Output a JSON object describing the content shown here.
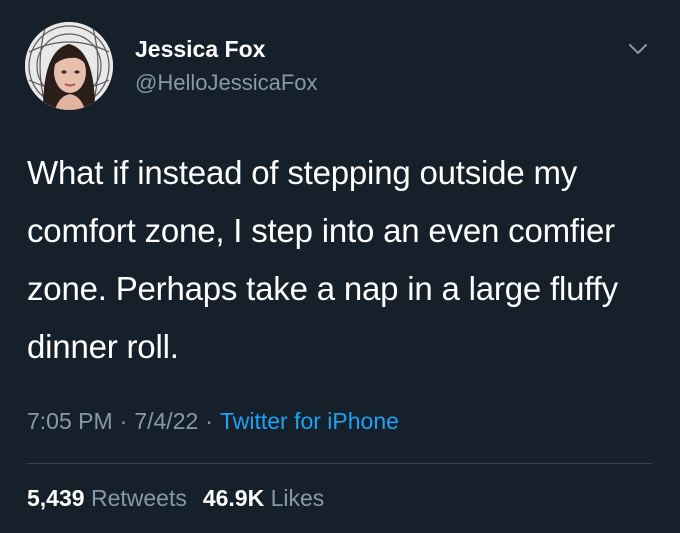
{
  "user": {
    "display_name": "Jessica Fox",
    "handle": "@HelloJessicaFox",
    "avatar_icon": "profile-photo"
  },
  "tweet": {
    "text": "What if instead of stepping outside my comfort zone, I step into an even comfier zone. Perhaps take a nap in a large fluffy dinner roll."
  },
  "meta": {
    "time": "7:05 PM",
    "separator": "·",
    "date": "7/4/22",
    "source": "Twitter for iPhone"
  },
  "stats": {
    "retweets_count": "5,439",
    "retweets_label": "Retweets",
    "likes_count": "46.9K",
    "likes_label": "Likes"
  },
  "colors": {
    "background": "#15202b",
    "primary_text": "#ffffff",
    "secondary_text": "#8899a6",
    "link": "#1da1f2",
    "divider": "#38444d"
  },
  "icons": {
    "more": "chevron-down-icon"
  }
}
